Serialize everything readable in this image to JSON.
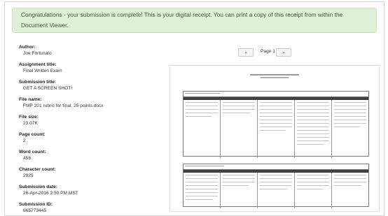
{
  "alert": {
    "message": "Congratulations - your submission is complete! This is your digital receipt. You can print a copy of this receipt from within the Document Viewer."
  },
  "fields": [
    {
      "label": "Author:",
      "value": "Joe Fortunato"
    },
    {
      "label": "Assignment title:",
      "value": "Final Written Exam"
    },
    {
      "label": "Submission title:",
      "value": "GET A SCREEN SHOT!"
    },
    {
      "label": "File name:",
      "value": "FMP 201 rubric for final. 25 points.docx"
    },
    {
      "label": "File size:",
      "value": "23.07K"
    },
    {
      "label": "Page count:",
      "value": "2"
    },
    {
      "label": "Word count:",
      "value": "458"
    },
    {
      "label": "Character count:",
      "value": "2925"
    },
    {
      "label": "Submission date:",
      "value": "26-Apr-2016 2:50 PM MST"
    },
    {
      "label": "Submission ID:",
      "value": "665773445"
    }
  ],
  "viewer": {
    "prev_label": "«",
    "page_label": "Page 1",
    "next_label": "»"
  },
  "colors": {
    "alert_bg": "#dff0d8",
    "alert_text": "#3c5a32",
    "table_header": "#404040"
  }
}
